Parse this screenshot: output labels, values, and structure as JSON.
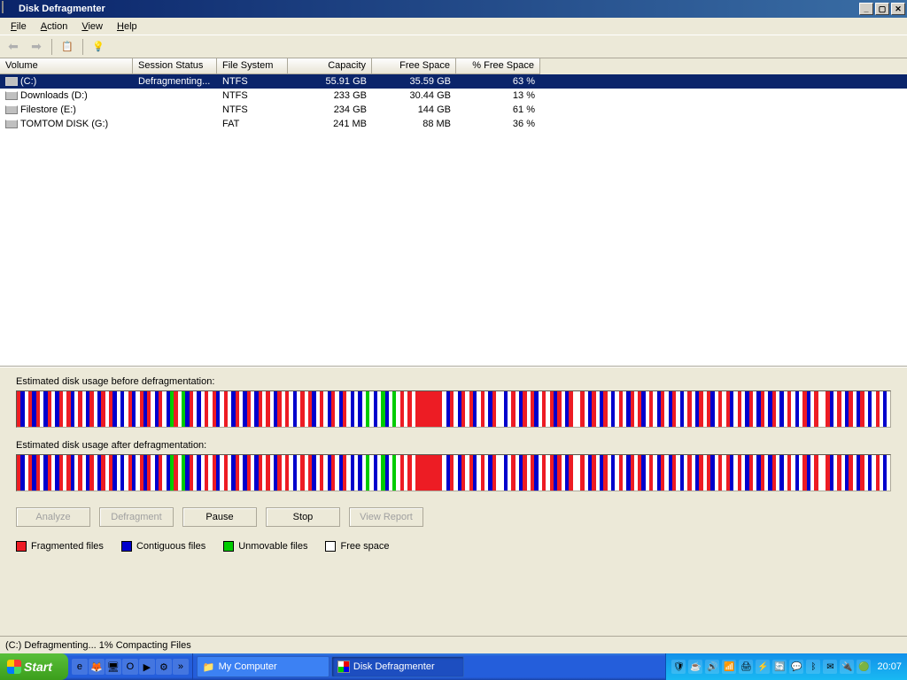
{
  "window": {
    "title": "Disk Defragmenter"
  },
  "menu": {
    "file": "File",
    "action": "Action",
    "view": "View",
    "help": "Help"
  },
  "columns": {
    "volume": "Volume",
    "status": "Session Status",
    "fs": "File System",
    "capacity": "Capacity",
    "free": "Free Space",
    "pct": "% Free Space"
  },
  "rows": [
    {
      "volume": "(C:)",
      "status": "Defragmenting...",
      "fs": "NTFS",
      "capacity": "55.91 GB",
      "free": "35.59 GB",
      "pct": "63 %",
      "selected": true
    },
    {
      "volume": "Downloads (D:)",
      "status": "",
      "fs": "NTFS",
      "capacity": "233 GB",
      "free": "30.44 GB",
      "pct": "13 %",
      "selected": false
    },
    {
      "volume": "Filestore (E:)",
      "status": "",
      "fs": "NTFS",
      "capacity": "234 GB",
      "free": "144 GB",
      "pct": "61 %",
      "selected": false
    },
    {
      "volume": "TOMTOM DISK (G:)",
      "status": "",
      "fs": "FAT",
      "capacity": "241 MB",
      "free": "88 MB",
      "pct": "36 %",
      "selected": false
    }
  ],
  "labels": {
    "before": "Estimated disk usage before defragmentation:",
    "after": "Estimated disk usage after defragmentation:"
  },
  "buttons": {
    "analyze": "Analyze",
    "defragment": "Defragment",
    "pause": "Pause",
    "stop": "Stop",
    "report": "View Report"
  },
  "legend": {
    "frag": "Fragmented files",
    "contig": "Contiguous files",
    "unmov": "Unmovable files",
    "free": "Free space"
  },
  "status_text": "(C:) Defragmenting... 1%  Compacting Files",
  "taskbar": {
    "start": "Start",
    "task1": "My Computer",
    "task2": "Disk Defragmenter",
    "clock": "20:07"
  },
  "frag_before": "rbwrbrwbrwbrwrbwrwbrwbrwrbwbwrbwrbrwbrwbgrwgbrwbwrwrbwrwbrwbrwbrwrwbrwrwbwrwrbwrwbrwbrwbwbwgwbwgbwgwrwrwrrrrrrrwbrwbrwrbwrwbrwwbwrwbrwrbwrwrbrwbrwwrwbrwbrwbwrwbrwrbwrwbrwbrwbwrwbrwrbwrwrbwrwbrwbrwbrwbwrwbwrbwrwwrbwrwbrwbrwbwrwb",
  "frag_after": "rbwrbrwbrwbrwrbwrwbrwbrwrbwbwrbwrbrwbrwbgrwgbrwbwrwrbwrwbrwbrwbrwrwbrwrwbwrwrbwrwbrwbrwbwbwgwbwgbwgwrwrwrrrrrrrwbrwbrwrbwrwbrwwbwrwbrwrbwrwrbrwbrwwrwbrwbrwbwrwbrwrbwrwbrwbrwbwrwbrwrbwrwrbwrwbrwbrwbrwbwrwbwrbwrwwrbwrwbrwbrwbwrwb"
}
